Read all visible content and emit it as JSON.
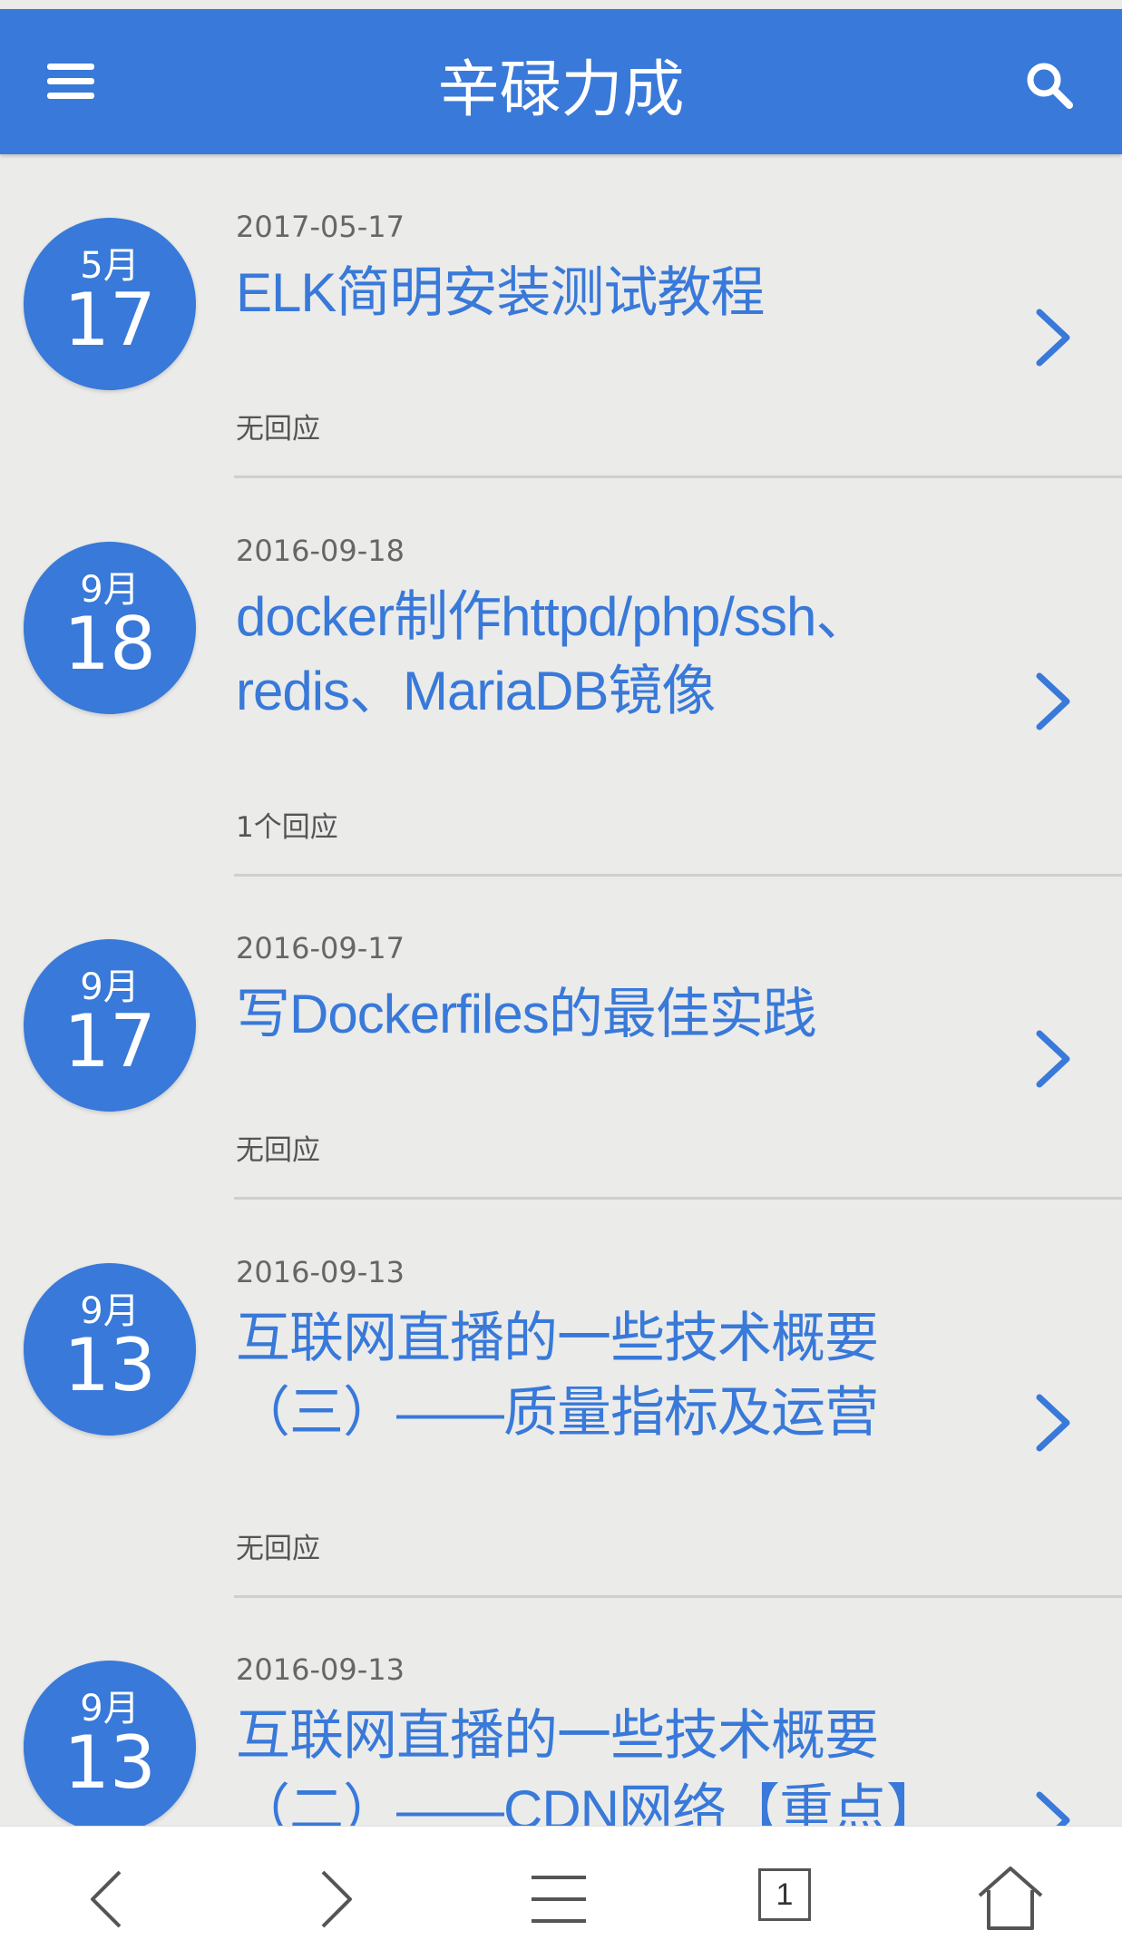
{
  "header": {
    "title": "辛碌力成",
    "menu_icon": "menu-icon",
    "search_icon": "search-icon"
  },
  "posts": [
    {
      "month": "5月",
      "day": "17",
      "date": "2017-05-17",
      "title": "ELK简明安装测试教程",
      "replies": "无回应"
    },
    {
      "month": "9月",
      "day": "18",
      "date": "2016-09-18",
      "title": "docker制作httpd/php/ssh、redis、MariaDB镜像",
      "replies": "1个回应"
    },
    {
      "month": "9月",
      "day": "17",
      "date": "2016-09-17",
      "title": "写Dockerfiles的最佳实践",
      "replies": "无回应"
    },
    {
      "month": "9月",
      "day": "13",
      "date": "2016-09-13",
      "title": "互联网直播的一些技术概要（三）——质量指标及运营",
      "replies": "无回应"
    },
    {
      "month": "9月",
      "day": "13",
      "date": "2016-09-13",
      "title": "互联网直播的一些技术概要（二）——CDN网络【重点】",
      "replies": ""
    }
  ],
  "bottom_bar": {
    "back_icon": "back-arrow-icon",
    "forward_icon": "forward-arrow-icon",
    "menu_icon": "menu-lines-icon",
    "tab_count": "1",
    "home_icon": "home-icon"
  },
  "colors": {
    "accent": "#3879d9",
    "background": "#ebebea",
    "bottom_bar": "#ffffff"
  }
}
